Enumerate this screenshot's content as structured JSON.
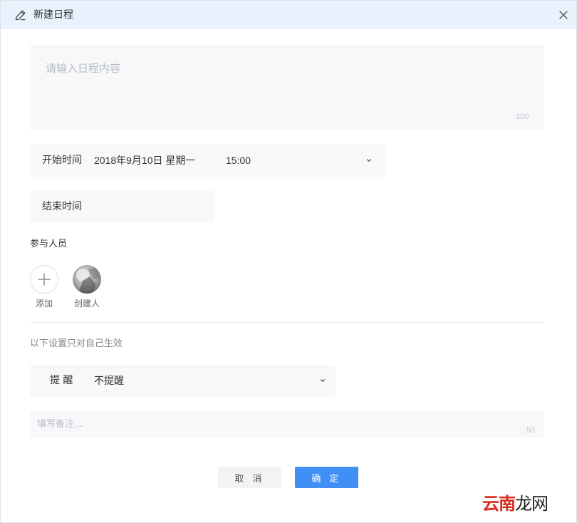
{
  "dialog": {
    "title": "新建日程",
    "icons": {
      "title_icon": "pen-icon",
      "close": "close-icon"
    }
  },
  "content": {
    "placeholder": "请输入日程内容",
    "counter": "100"
  },
  "start_time": {
    "label": "开始时间",
    "date": "2018年9月10日 星期一",
    "time": "15:00",
    "icon": "chevron-down-icon"
  },
  "end_time": {
    "label": "结束时间"
  },
  "participants": {
    "label": "参与人员",
    "add_label": "添加",
    "creator_label": "创建人"
  },
  "personal": {
    "note": "以下设置只对自己生效"
  },
  "reminder": {
    "label": "提 醒",
    "value": "不提醒",
    "icon": "chevron-down-icon"
  },
  "remark": {
    "placeholder": "填写备注...",
    "counter": "50"
  },
  "buttons": {
    "cancel": "取 消",
    "ok": "确 定"
  },
  "watermark": {
    "part1": "云南",
    "part2": "龙网"
  },
  "colors": {
    "titlebar_bg": "#e8f2fc",
    "field_bg": "#f7f8fa",
    "primary": "#3f8ff5",
    "watermark_red": "#d92a1d"
  }
}
